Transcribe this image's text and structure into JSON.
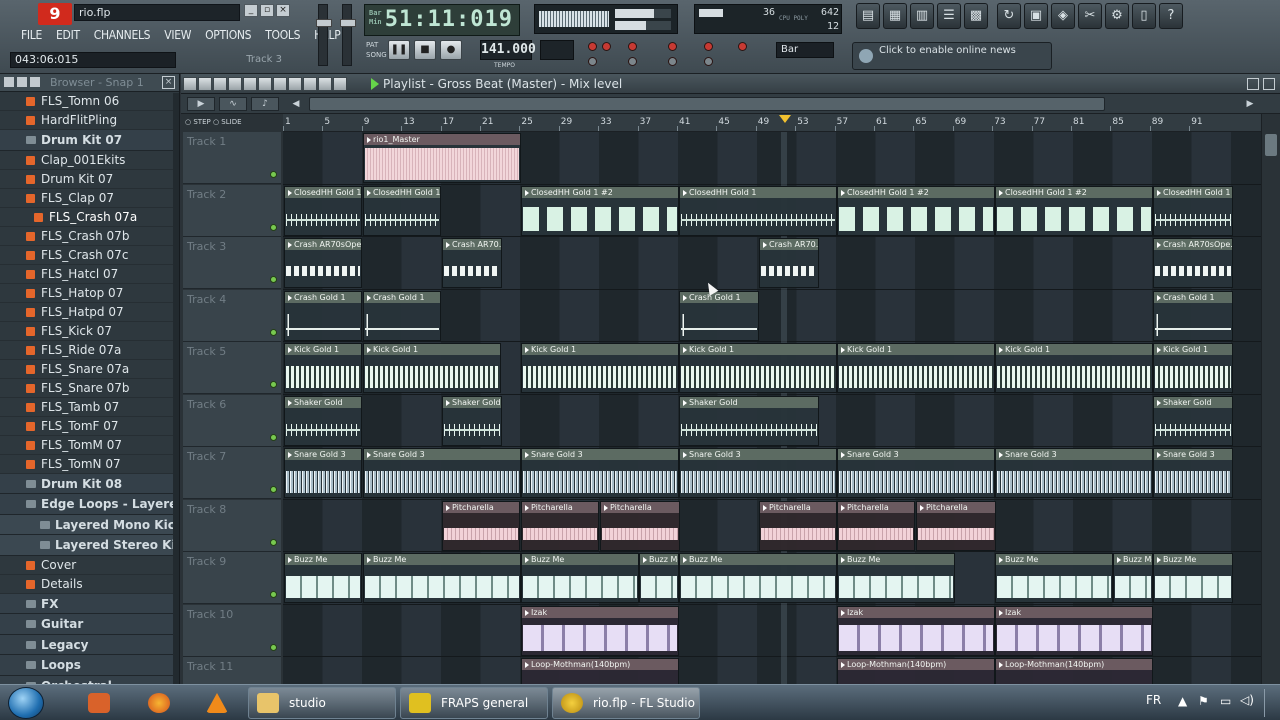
{
  "app": {
    "logo_text": "9",
    "file_name": "rio.flp",
    "time_display": "043:06:015",
    "track_hint": "Track 3",
    "menu": [
      "FILE",
      "EDIT",
      "CHANNELS",
      "VIEW",
      "OPTIONS",
      "TOOLS",
      "HELP"
    ]
  },
  "transport": {
    "song_position": "51:11:019",
    "tempo": "141.000",
    "tempo_label": "TEMPO",
    "pat_label": "PAT",
    "song_label": "SONG",
    "snap": "Bar",
    "cpu_value": "36",
    "ram_value": "642",
    "poly_value": "12",
    "news": "Click to enable online news"
  },
  "browser": {
    "title": "Browser - Snap 1",
    "items": [
      {
        "label": "FLS_Tomn 06",
        "type": "file"
      },
      {
        "label": "HardFlitPling",
        "type": "file"
      },
      {
        "label": "Drum Kit 07",
        "type": "folder"
      },
      {
        "label": "Clap_001Ekits",
        "type": "file"
      },
      {
        "label": "Drum Kit 07",
        "type": "file"
      },
      {
        "label": "FLS_Clap 07",
        "type": "file"
      },
      {
        "label": "FLS_Crash 07a",
        "type": "file-selected"
      },
      {
        "label": "FLS_Crash 07b",
        "type": "file"
      },
      {
        "label": "FLS_Crash 07c",
        "type": "file"
      },
      {
        "label": "FLS_Hatcl 07",
        "type": "file"
      },
      {
        "label": "FLS_Hatop 07",
        "type": "file"
      },
      {
        "label": "FLS_Hatpd 07",
        "type": "file"
      },
      {
        "label": "FLS_Kick 07",
        "type": "file"
      },
      {
        "label": "FLS_Ride 07a",
        "type": "file"
      },
      {
        "label": "FLS_Snare 07a",
        "type": "file"
      },
      {
        "label": "FLS_Snare 07b",
        "type": "file"
      },
      {
        "label": "FLS_Tamb 07",
        "type": "file"
      },
      {
        "label": "FLS_TomF 07",
        "type": "file"
      },
      {
        "label": "FLS_TomM 07",
        "type": "file"
      },
      {
        "label": "FLS_TomN 07",
        "type": "file"
      },
      {
        "label": "Drum Kit 08",
        "type": "folder"
      },
      {
        "label": "Edge Loops - Layere...",
        "type": "folder"
      },
      {
        "label": "Layered Mono Kic...",
        "type": "subfolder"
      },
      {
        "label": "Layered Stereo Ki...",
        "type": "subfolder"
      },
      {
        "label": "Cover",
        "type": "file"
      },
      {
        "label": "Details",
        "type": "file"
      },
      {
        "label": "FX",
        "type": "folder"
      },
      {
        "label": "Guitar",
        "type": "folder"
      },
      {
        "label": "Legacy",
        "type": "folder"
      },
      {
        "label": "Loops",
        "type": "folder"
      },
      {
        "label": "Orchestral",
        "type": "folder"
      }
    ]
  },
  "playlist": {
    "title": "Playlist - Gross Beat (Master) - Mix level",
    "step_label": "STEP",
    "slide_label": "SLIDE",
    "ruler": [
      "1",
      "5",
      "9",
      "13",
      "17",
      "21",
      "25",
      "29",
      "33",
      "37",
      "41",
      "45",
      "49",
      "53",
      "57",
      "61",
      "65",
      "69",
      "73",
      "77",
      "81",
      "85",
      "89",
      "91"
    ],
    "tracks": [
      "Track 1",
      "Track 2",
      "Track 3",
      "Track 4",
      "Track 5",
      "Track 6",
      "Track 7",
      "Track 8",
      "Track 9",
      "Track 10",
      "Track 11"
    ],
    "clip_names": {
      "master": "rio1_Master",
      "hh": "ClosedHH Gold 1",
      "hh2": "ClosedHH Gold 1 #2",
      "crash_ar": "Crash AR70sOpe...",
      "crash_ar_short": "Crash AR70...",
      "crash": "Crash Gold 1",
      "kick": "Kick Gold 1",
      "shaker": "Shaker Gold",
      "snare": "Snare Gold 3",
      "pitch": "Pitcharella",
      "buzz": "Buzz Me",
      "izak": "Izak",
      "loop": "Loop-Mothman(140bpm)"
    }
  },
  "taskbar": {
    "tasks": [
      "studio",
      "FRAPS general",
      "rio.flp - FL Studio ..."
    ],
    "lang": "FR"
  }
}
